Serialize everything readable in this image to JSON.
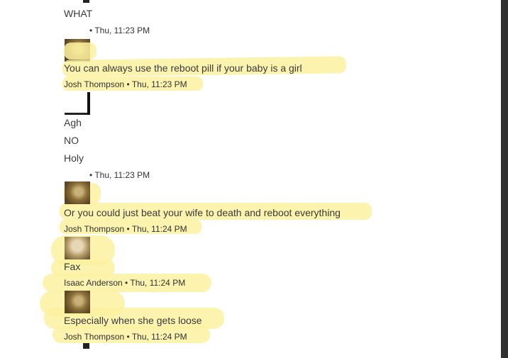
{
  "messages": [
    {
      "text": "WHAT"
    },
    {
      "meta": "• Thu, 11:23 PM"
    },
    {
      "text": "You can always use the reboot pill if your baby is a girl"
    },
    {
      "meta": "Josh Thompson • Thu, 11:23 PM"
    },
    {
      "text": "Agh"
    },
    {
      "text": "NO"
    },
    {
      "text": "Holy"
    },
    {
      "meta": "• Thu, 11:23 PM"
    },
    {
      "text": "Or you could just beat your wife to death and reboot everything"
    },
    {
      "meta": "Josh Thompson • Thu, 11:24 PM"
    },
    {
      "text": "Fax"
    },
    {
      "meta": "Isaac Anderson • Thu, 11:24 PM"
    },
    {
      "text": "Especially when she gets loose"
    },
    {
      "meta": "Josh Thompson • Thu, 11:24 PM"
    }
  ],
  "highlight_color": "#fbf1a0"
}
